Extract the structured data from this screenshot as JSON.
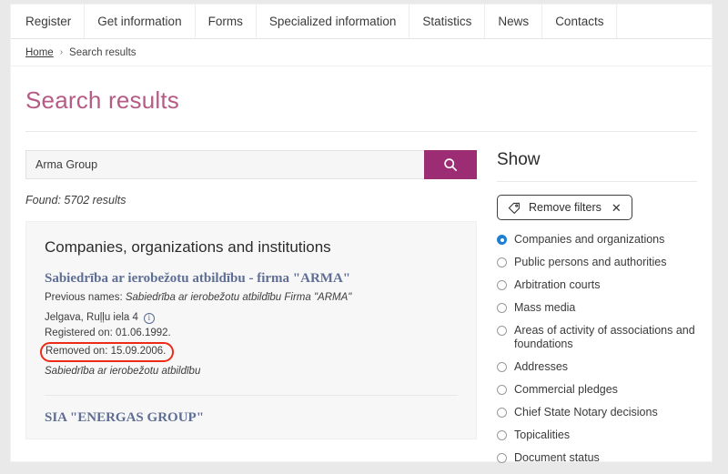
{
  "nav": {
    "items": [
      {
        "label": "Register"
      },
      {
        "label": "Get information"
      },
      {
        "label": "Forms"
      },
      {
        "label": "Specialized information"
      },
      {
        "label": "Statistics"
      },
      {
        "label": "News"
      },
      {
        "label": "Contacts"
      }
    ]
  },
  "breadcrumb": {
    "home": "Home",
    "separator": "›",
    "current": "Search results"
  },
  "page": {
    "title": "Search results"
  },
  "search": {
    "value": "Arma Group",
    "placeholder": "Arma Group",
    "button_icon": "search-icon",
    "found_text": "Found: 5702 results",
    "accent_color": "#9c2d74"
  },
  "result_card": {
    "heading": "Companies, organizations and institutions",
    "entity": {
      "name": "Sabiedrība ar ierobežotu atbildību - firma \"ARMA\"",
      "previous_names_label": "Previous names:",
      "previous_names_value": "Sabiedrība ar ierobežotu atbildību Firma \"ARMA\"",
      "address": "Jelgava, Ruļļu iela 4",
      "address_info_icon": "info-icon",
      "registered_on": "Registered on: 01.06.1992.",
      "removed_on": "Removed on: 15.09.2006.",
      "removed_on_highlight_color": "#ee2b18",
      "entity_type": "Sabiedrība ar ierobežotu atbildību"
    },
    "next_entity": {
      "name": "SIA \"ENERGAS GROUP\""
    }
  },
  "sidebar": {
    "title": "Show",
    "remove_filters": {
      "label": "Remove filters",
      "tag_icon": "tag-icon",
      "close_icon": "close-icon"
    },
    "filters": [
      {
        "label": "Companies and organizations",
        "selected": true
      },
      {
        "label": "Public persons and authorities",
        "selected": false
      },
      {
        "label": "Arbitration courts",
        "selected": false
      },
      {
        "label": "Mass media",
        "selected": false
      },
      {
        "label": "Areas of activity of associations and foundations",
        "selected": false
      },
      {
        "label": "Addresses",
        "selected": false
      },
      {
        "label": "Commercial pledges",
        "selected": false
      },
      {
        "label": "Chief State Notary decisions",
        "selected": false
      },
      {
        "label": "Topicalities",
        "selected": false
      },
      {
        "label": "Document status",
        "selected": false
      }
    ]
  }
}
